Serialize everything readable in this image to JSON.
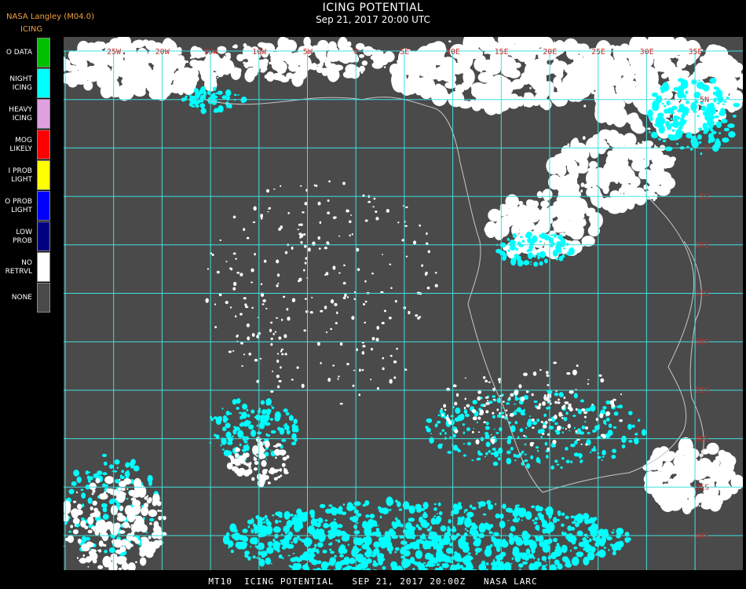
{
  "header": {
    "title": "ICING POTENTIAL",
    "subtitle": "Sep 21, 2017 20:00 UTC",
    "org": "NASA Langley (M04.0)",
    "product": "ICING"
  },
  "legend": [
    {
      "label": "O DATA",
      "color": "#00c000"
    },
    {
      "label": "NIGHT\nICING",
      "color": "#00ffff"
    },
    {
      "label": "HEAVY\nICING",
      "color": "#e0a0e0"
    },
    {
      "label": "MOG\nLIKELY",
      "color": "#ff0000"
    },
    {
      "label": "I PROB\nLIGHT",
      "color": "#ffff00"
    },
    {
      "label": "O PROB\nLIGHT",
      "color": "#0000ff"
    },
    {
      "label": "LOW\nPROB",
      "color": "#000080"
    },
    {
      "label": "NO\nRETRVL",
      "color": "#ffffff"
    },
    {
      "label": "NONE",
      "color": "#4a4a4a"
    }
  ],
  "map": {
    "grid_color": "#40e0e0",
    "label_color": "#c03030",
    "lon_labels": [
      "25W",
      "20W",
      "15W",
      "10W",
      "5W",
      "0",
      "5E",
      "10E",
      "15E",
      "20E",
      "25E",
      "30E",
      "35E"
    ],
    "lat_labels": [
      "5N",
      "0",
      "5S",
      "10S",
      "15S",
      "20S",
      "25S",
      "30S",
      "35S",
      "40S"
    ]
  },
  "footer": "MT10  ICING POTENTIAL   SEP 21, 2017 20:00Z   NASA LARC"
}
